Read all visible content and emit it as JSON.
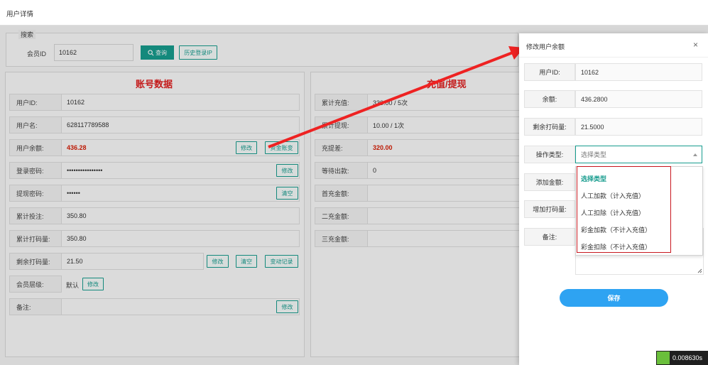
{
  "window": {
    "title": "用户详情"
  },
  "search": {
    "legend": "搜索",
    "member_id_label": "会员ID",
    "member_id_value": "10162",
    "query_button": "查询",
    "history_ip_button": "历史登录IP"
  },
  "account": {
    "title": "账号数据",
    "rows": [
      {
        "label": "用户ID:",
        "value": "10162"
      },
      {
        "label": "用户名:",
        "value": "628117789588"
      },
      {
        "label": "用户余额:",
        "value": "436.28",
        "buttons": [
          "修改",
          "资金账变"
        ]
      },
      {
        "label": "登录密码:",
        "value": "••••••••••••••••",
        "buttons": [
          "修改"
        ]
      },
      {
        "label": "提现密码:",
        "value": "••••••",
        "buttons": [
          "清空"
        ]
      },
      {
        "label": "累计投注:",
        "value": "350.80"
      },
      {
        "label": "累计打码量:",
        "value": "350.80"
      },
      {
        "label": "剩余打码量:",
        "value": "21.50",
        "buttons": [
          "修改",
          "清空",
          "变动记录"
        ]
      },
      {
        "label": "会员层级:",
        "value": "默认",
        "buttons": [
          "修改"
        ]
      },
      {
        "label": "备注:",
        "value": "",
        "buttons": [
          "修改"
        ]
      }
    ]
  },
  "recharge": {
    "title": "充值/提现",
    "rows": [
      {
        "label": "累计充值:",
        "value": "330.00 / 5次"
      },
      {
        "label": "累计提现:",
        "value": "10.00 / 1次"
      },
      {
        "label": "充提差:",
        "value": "320.00"
      },
      {
        "label": "等待出款:",
        "value": "0"
      },
      {
        "label": "首充金额:",
        "value": ""
      },
      {
        "label": "二充金额:",
        "value": ""
      },
      {
        "label": "三充金额:",
        "value": ""
      }
    ]
  },
  "modal": {
    "title": "修改用户余额",
    "close": "×",
    "user_id_label": "用户ID:",
    "user_id_value": "10162",
    "balance_label": "余额:",
    "balance_value": "436.2800",
    "remaining_label": "剩余打码量:",
    "remaining_value": "21.5000",
    "op_type_label": "操作类型:",
    "op_type_placeholder": "选择类型",
    "add_amount_label": "添加金额:",
    "add_code_label": "增加打码量:",
    "note_label": "备注:",
    "save_button": "保存",
    "options": [
      "选择类型",
      "人工加款（计入充值）",
      "人工扣除（计入充值）",
      "彩金加款（不计入充值）",
      "彩金扣除（不计入充值）"
    ]
  },
  "timer": {
    "text": "0.008630s"
  },
  "colors": {
    "accent": "#179c8e",
    "red": "#d81e06",
    "save": "#2ea3f2",
    "arrow": "#ee2222"
  }
}
